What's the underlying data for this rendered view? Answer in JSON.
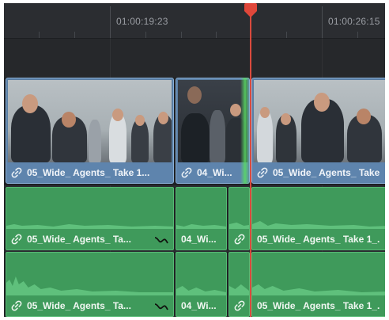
{
  "ruler": {
    "timecode_1": "01:00:19:23",
    "timecode_2": "01:00:26:15"
  },
  "video_clips": [
    {
      "label": "05_Wide_ Agents_ Take 1..."
    },
    {
      "label": "04_Wi..."
    },
    {
      "label": "05_Wide_ Agents_ Take"
    }
  ],
  "audio_track_1": {
    "clips": [
      {
        "label": "05_Wide_ Agents_ Ta..."
      },
      {
        "label": "04_Wi..."
      },
      {
        "label": ""
      },
      {
        "label": "05_Wide_ Agents_ Take 1_."
      }
    ]
  },
  "audio_track_2": {
    "clips": [
      {
        "label": "05_Wide_ Agents_ Ta..."
      },
      {
        "label": "04_Wi..."
      },
      {
        "label": ""
      },
      {
        "label": "05_Wide_ Agents_ Take 1_."
      }
    ]
  },
  "colors": {
    "video_clip": "#5e84ad",
    "audio_clip": "#3f9a5b",
    "playhead": "#d94a3d"
  },
  "icons": {
    "link": "link-icon",
    "fade_curve": "fade-curve-icon",
    "playhead": "playhead-marker-icon"
  }
}
